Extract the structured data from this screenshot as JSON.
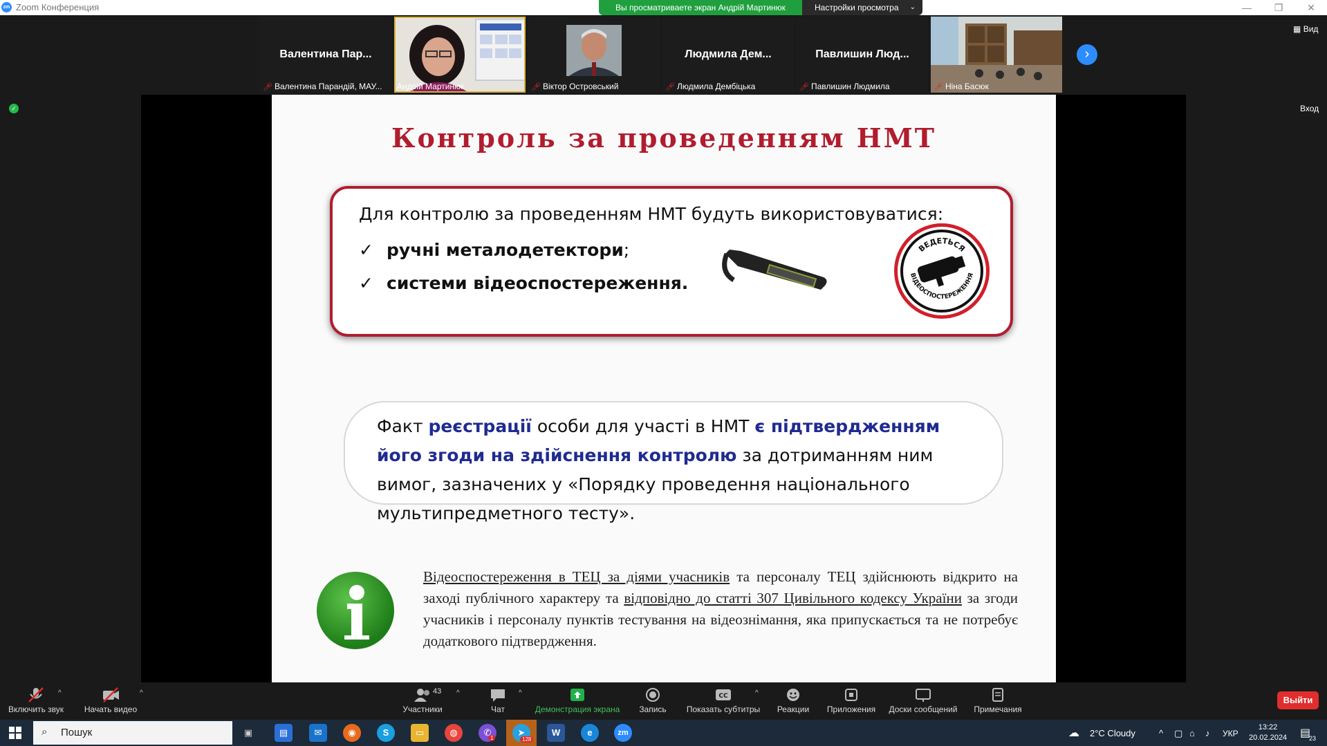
{
  "titlebar": {
    "app_logo": "zm",
    "title": "Zoom Конференция"
  },
  "banner": {
    "sharing_text": "Вы просматриваете экран Андрій Мартинюк",
    "view_settings": "Настройки просмотра"
  },
  "thumbnails": [
    {
      "big_name": "Валентина Пар...",
      "caption": "Валентина Парандій, МАУ...",
      "muted": true
    },
    {
      "big_name": "",
      "caption": "Андрій Мартинюк",
      "muted": false
    },
    {
      "big_name": "",
      "caption": "Віктор Островський",
      "muted": true
    },
    {
      "big_name": "Людмила Дем...",
      "caption": "Людмила Дембіцька",
      "muted": true
    },
    {
      "big_name": "Павлишин Люд...",
      "caption": "Павлишин Людмила",
      "muted": true
    },
    {
      "big_name": "",
      "caption": "Ніна Басюк",
      "muted": true
    }
  ],
  "side": {
    "view": "Вид",
    "enter": "Вход"
  },
  "slide": {
    "title": "Контроль за проведенням НМТ",
    "box1_intro": "Для контролю за проведенням НМТ будуть використовуватися:",
    "bullet1": "ручні металодетектори",
    "bullet1_tail": ";",
    "bullet2": "системи відеоспостереження.",
    "cctv_top": "ВЕДЕТЬСЯ",
    "cctv_bottom": "ВІДЕОСПОСТЕРЕЖЕННЯ",
    "box2": {
      "p1": "Факт ",
      "h1": "реєстрації",
      "p2": " особи для участі в НМТ ",
      "h2": "є підтвердженням його згоди на здійснення контролю",
      "p3": " за дотриманням ним вимог, зазначених у «Порядку проведення національного мультипредметного тесту»."
    },
    "info": {
      "u1": "Відеоспостереження в ТЕЦ за діями учасників",
      "t1": " та персоналу ТЕЦ здійснюють відкрито на заході публічного характеру та ",
      "u2": "відповідно до статті 307 Цивільного кодексу України",
      "t2": " за згоди учасників і персоналу пунктів тестування на відеознімання, яка припускається та не потребує додаткового підтвердження."
    }
  },
  "toolbar": {
    "unmute": "Включить звук",
    "start_video": "Начать видео",
    "participants": "Участники",
    "participants_count": "43",
    "chat": "Чат",
    "share": "Демонстрация экрана",
    "record": "Запись",
    "captions": "Показать субтитры",
    "reactions": "Реакции",
    "apps": "Приложения",
    "whiteboards": "Доски сообщений",
    "notes": "Примечания",
    "leave": "Выйти"
  },
  "taskbar": {
    "search_placeholder": "Пошук",
    "weather": "2°C  Cloudy",
    "lang": "УКР",
    "time": "13:22",
    "date": "20.02.2024",
    "telegram_badge": "128",
    "viber_badge": "1",
    "notif_count": "23",
    "word_label": "W",
    "zoom_label": "zm"
  },
  "colors": {
    "accent": "#2d8cff",
    "share_green": "#1f9f3e",
    "slide_red": "#b01d2e",
    "slide_blue": "#1f2b8f",
    "leave_red": "#e22d2d"
  }
}
